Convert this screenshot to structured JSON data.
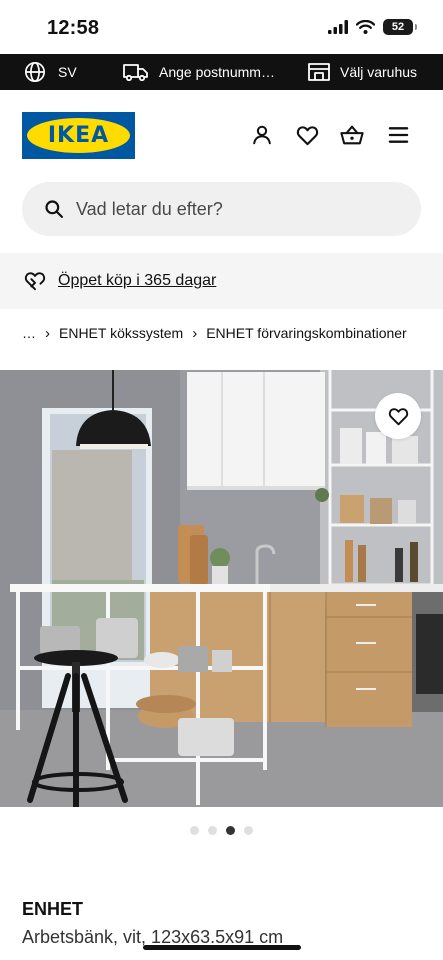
{
  "status_bar": {
    "time": "12:58",
    "battery": "52"
  },
  "utility_bar": {
    "language": "SV",
    "delivery": "Ange postnumm…",
    "store": "Välj varuhus"
  },
  "header": {
    "logo_text": "IKEA"
  },
  "search": {
    "placeholder": "Vad letar du efter?"
  },
  "promo": {
    "text": "Öppet köp i 365 dagar"
  },
  "breadcrumb": [
    "…",
    "ENHET kökssystem",
    "ENHET förvaringskombinationer"
  ],
  "carousel": {
    "total": 4,
    "active_index": 3
  },
  "product": {
    "name": "ENHET",
    "description": "Arbetsbänk, vit, 123x63.5x91 cm"
  },
  "colors": {
    "brand_blue": "#0058a3",
    "brand_yellow": "#ffdb00",
    "utility_bar_bg": "#111111"
  }
}
